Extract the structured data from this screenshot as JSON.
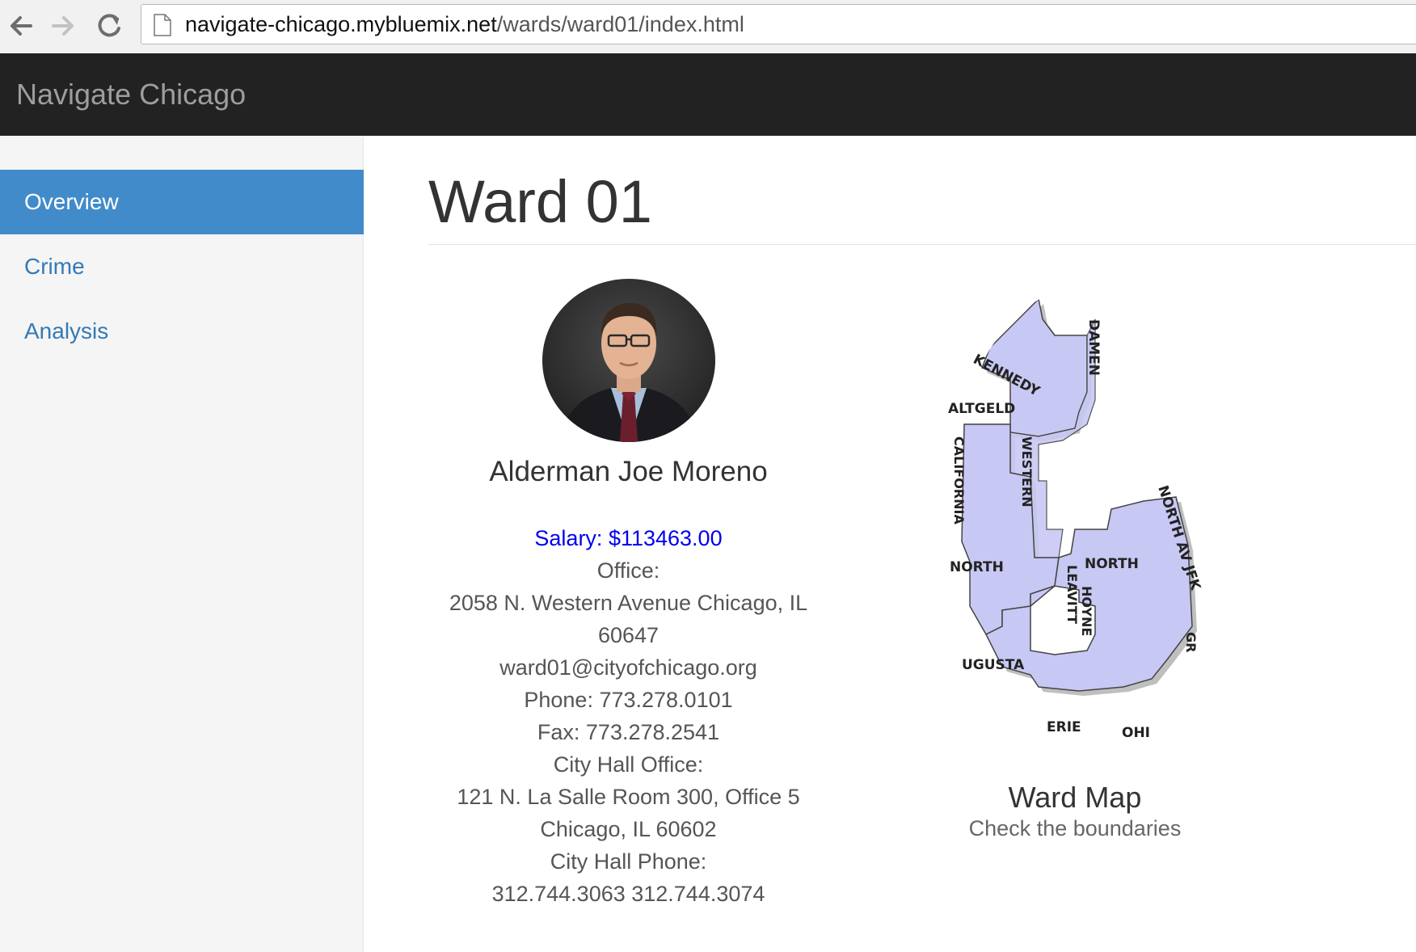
{
  "browser": {
    "url_host": "navigate-chicago.mybluemix.net",
    "url_path": "/wards/ward01/index.html"
  },
  "navbar": {
    "brand": "Navigate Chicago"
  },
  "sidebar": {
    "items": [
      {
        "label": "Overview",
        "active": true
      },
      {
        "label": "Crime",
        "active": false
      },
      {
        "label": "Analysis",
        "active": false
      }
    ]
  },
  "main": {
    "title": "Ward 01",
    "alderman": {
      "name": "Alderman Joe Moreno",
      "salary": "Salary: $113463.00",
      "office_label": "Office:",
      "office_address_1": "2058 N. Western Avenue Chicago, IL",
      "office_address_2": "60647",
      "email": "ward01@cityofchicago.org",
      "phone": "Phone: 773.278.0101",
      "fax": "Fax: 773.278.2541",
      "city_hall_label": "City Hall Office:",
      "city_hall_address_1": "121 N. La Salle Room 300, Office 5",
      "city_hall_address_2": "Chicago, IL 60602",
      "city_hall_phone_label": "City Hall Phone:",
      "city_hall_phones": "312.744.3063 312.744.3074"
    },
    "map": {
      "title": "Ward Map",
      "subtitle": "Check the boundaries",
      "street_labels": {
        "kennedy": "KENNEDY",
        "damen": "DAMEN",
        "altgeld": "ALTGELD",
        "california": "CALIFORNIA",
        "western": "WESTERN",
        "north_av_jfk": "NORTH AV JFK",
        "north_left": "NORTH",
        "north_right": "NORTH",
        "leavitt": "LEAVITT",
        "hoyne": "HOYNE",
        "augusta": "UGUSTA",
        "erie": "ERIE",
        "ohio": "OHI",
        "gr": "GR"
      }
    }
  },
  "colors": {
    "navbar_bg": "#222222",
    "sidebar_active": "#428bca",
    "link": "#337ab7",
    "salary": "#0000ee",
    "ward_fill": "#c8c8f4"
  }
}
